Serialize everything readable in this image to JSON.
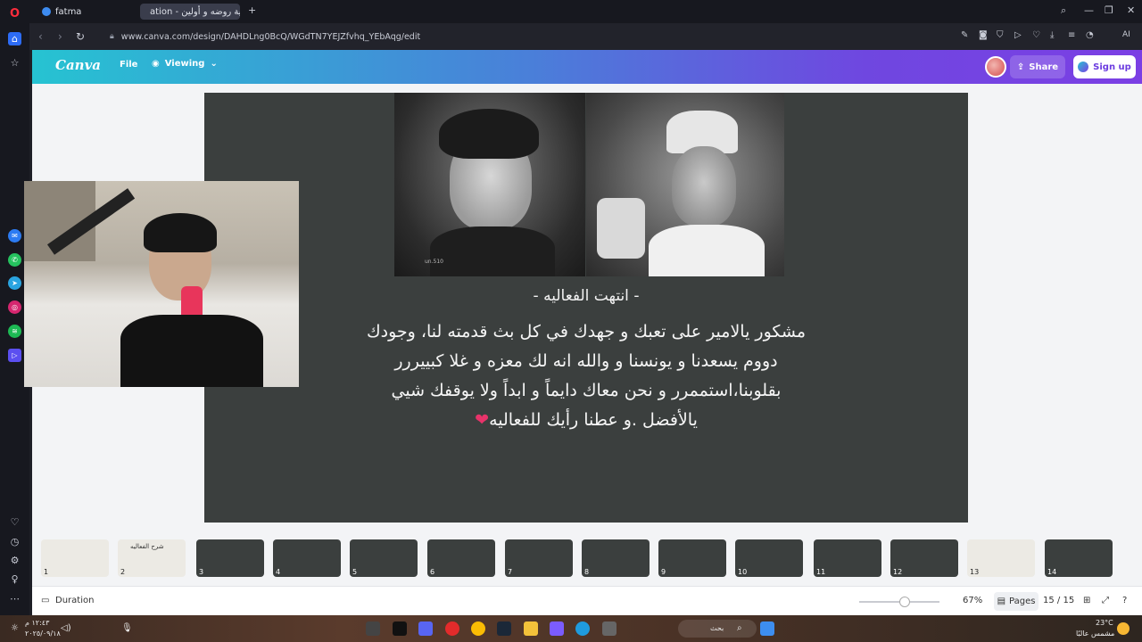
{
  "browser": {
    "tabs": [
      {
        "label": "fatma",
        "active": false
      },
      {
        "label": "ation - فعالية روضه و أولين",
        "active": true
      }
    ],
    "new_tab": "+",
    "url": "www.canva.com/design/DAHDLng0BcQ/WGdTN7YEJZfvhq_YEbAqg/edit",
    "ai_label": "AI"
  },
  "canva": {
    "logo": "Canva",
    "file_label": "File",
    "viewing_label": "Viewing",
    "share_label": "Share",
    "signup_label": "Sign up"
  },
  "slide": {
    "title": "- انتهت الفعاليه -",
    "body": "مشكور يالامير على تعبك و جهدك في كل بث قدمته لنا، وجودك دووم يسعدنا و يونسنا و والله انه لك معزه و غلا كبييررر بقلوبنا،استممرر و نحن معاك دايماً و ابداً ولا يوقفك شيي يالأفضل .و عطنا رأيك للفعاليه",
    "heart": "❤",
    "photo_left_watermark": "un.510"
  },
  "thumbnails": [
    {
      "num": "1",
      "tone": "light"
    },
    {
      "num": "2",
      "tone": "light",
      "caption": "شرح الفعاليه"
    },
    {
      "num": "3",
      "tone": "dark"
    },
    {
      "num": "4",
      "tone": "dark"
    },
    {
      "num": "5",
      "tone": "dark"
    },
    {
      "num": "6",
      "tone": "dark"
    },
    {
      "num": "7",
      "tone": "dark"
    },
    {
      "num": "8",
      "tone": "dark"
    },
    {
      "num": "9",
      "tone": "dark"
    },
    {
      "num": "10",
      "tone": "dark"
    },
    {
      "num": "11",
      "tone": "dark"
    },
    {
      "num": "12",
      "tone": "dark"
    },
    {
      "num": "13",
      "tone": "light"
    },
    {
      "num": "14",
      "tone": "dark"
    }
  ],
  "bottom": {
    "duration_label": "Duration",
    "zoom": "67%",
    "pages_label": "Pages",
    "page_counter": "15 / 15"
  },
  "taskbar": {
    "search_placeholder": "بحث",
    "weather_temp": "23°C",
    "weather_desc": "مشمس عالبًا",
    "time": "١٢:٤٣ م",
    "date": "٢٠٢٥/٠٩/١٨"
  },
  "colors": {
    "slide_bg": "#3b3f3e",
    "canva_gradient_start": "#26c3d2",
    "canva_gradient_end": "#7b3fe4",
    "heart": "#e8336a"
  }
}
